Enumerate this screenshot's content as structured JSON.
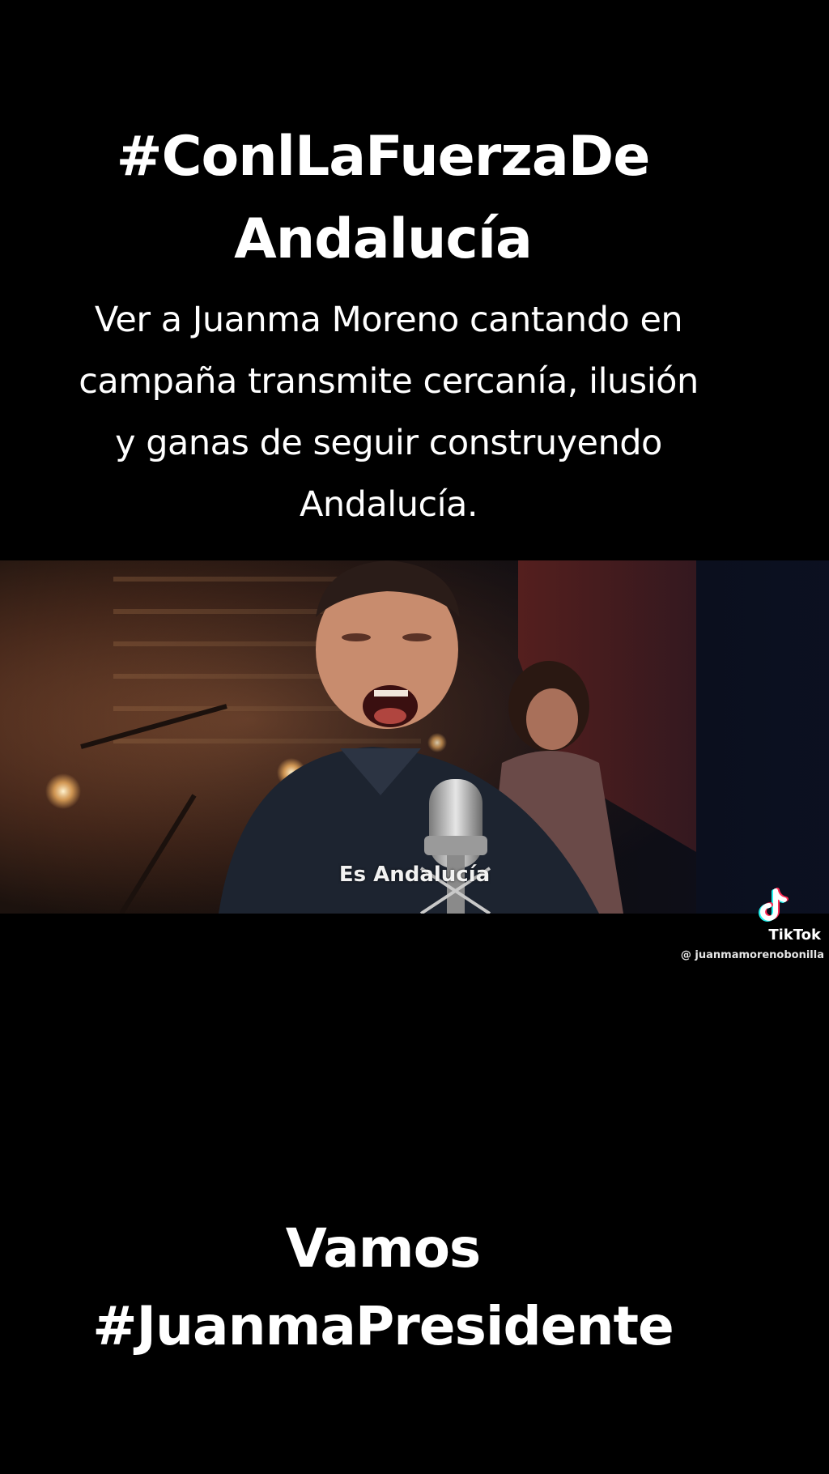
{
  "headline": {
    "line1": "#ConlLaFuerzaDe",
    "line2": "Andalucía"
  },
  "caption": {
    "line1": "Ver a Juanma Moreno cantando en",
    "line2": "campaña transmite cercanía, ilusión",
    "line3": "y ganas de seguir construyendo",
    "line4": "Andalucía."
  },
  "video": {
    "subtitle": "Es Andalucía"
  },
  "watermark": {
    "brand": "TikTok",
    "handle": "@ juanmamorenobonilla",
    "icon": "tiktok-icon"
  },
  "footer": {
    "line1": "Vamos",
    "line2": "#JuanmaPresidente"
  },
  "colors": {
    "background": "#000000",
    "text": "#ffffff",
    "tiktok_cyan": "#25f4ee",
    "tiktok_red": "#fe2c55"
  }
}
